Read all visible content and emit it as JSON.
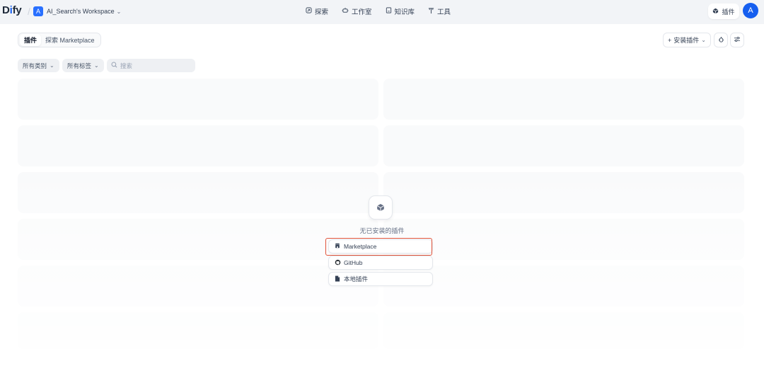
{
  "header": {
    "logo_prefix": "D",
    "logo_i": "i",
    "logo_suffix": "fy",
    "separator": "/",
    "workspace_avatar": "A",
    "workspace_name": "AI_Search's Workspace",
    "workspace_chevron": "chevron-down-icon",
    "nav": [
      {
        "label": "探索",
        "icon": "explore-icon"
      },
      {
        "label": "工作室",
        "icon": "studio-icon"
      },
      {
        "label": "知识库",
        "icon": "knowledge-icon"
      },
      {
        "label": "工具",
        "icon": "tools-icon"
      }
    ],
    "plugins_label": "插件",
    "user_avatar": "A"
  },
  "tabs": [
    {
      "label": "插件",
      "active": true
    },
    {
      "label": "探索 Marketplace",
      "active": false
    }
  ],
  "toolbar": {
    "install_label": "安装插件",
    "install_prefix": "+",
    "debug_icon": "bug-icon",
    "settings_icon": "settings-icon"
  },
  "filters": {
    "category_label": "所有类别",
    "tags_label": "所有标签",
    "search_placeholder": "搜索"
  },
  "empty_state": {
    "icon": "box-icon",
    "text": "无已安装的插件",
    "options": [
      {
        "label": "Marketplace",
        "icon": "marketplace-icon"
      },
      {
        "label": "GitHub",
        "icon": "github-icon"
      },
      {
        "label": "本地插件",
        "icon": "file-icon"
      }
    ]
  },
  "colors": {
    "accent": "#155eef",
    "highlight": "#e0533a",
    "topbar_bg": "#f2f4f7"
  }
}
